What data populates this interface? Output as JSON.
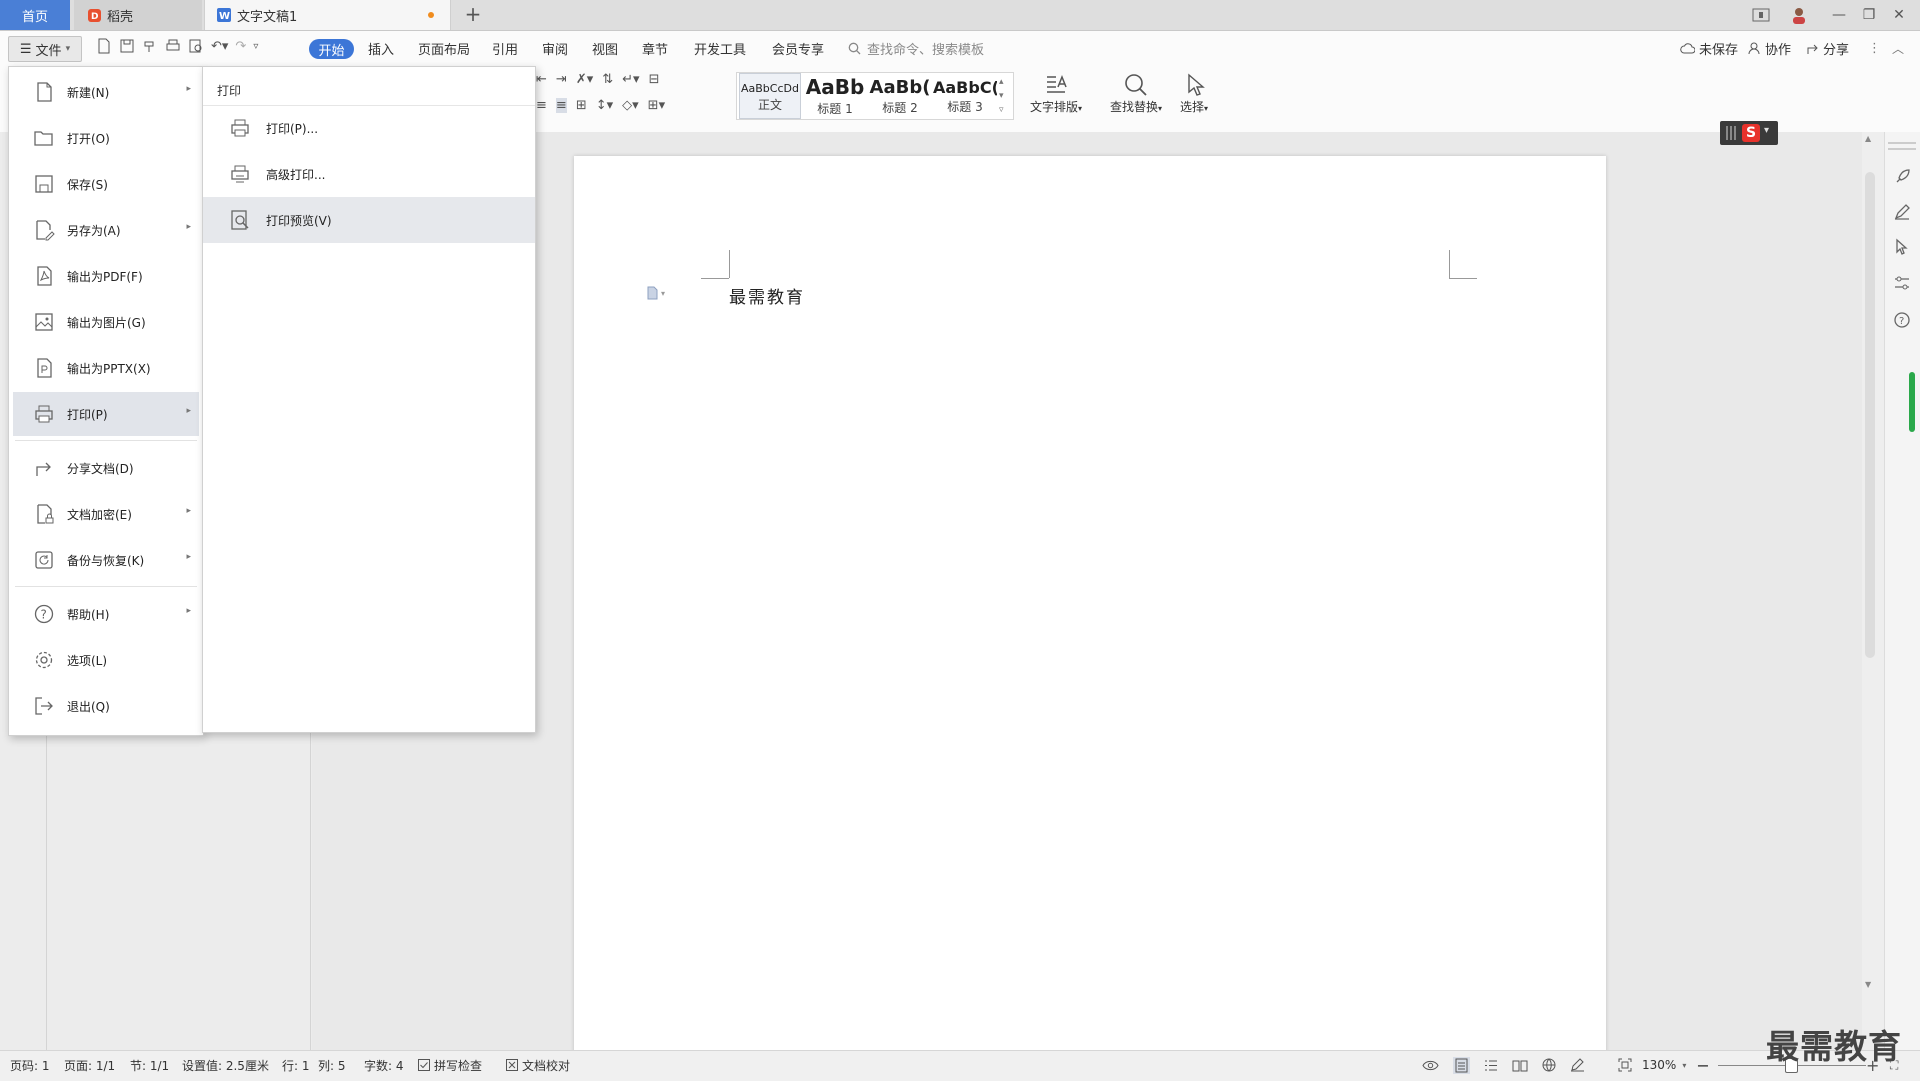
{
  "tabs": {
    "home": "首页",
    "docer": "稻壳",
    "document": "文字文稿1",
    "new_tab": "+"
  },
  "menubar": {
    "file": "文件",
    "items": [
      "开始",
      "插入",
      "页面布局",
      "引用",
      "审阅",
      "视图",
      "章节",
      "开发工具",
      "会员专享"
    ],
    "search_placeholder": "查找命令、搜索模板",
    "right": {
      "unsaved": "未保存",
      "collab": "协作",
      "share": "分享"
    }
  },
  "ribbon": {
    "styles": [
      {
        "sample": "AaBbCcDd",
        "label": "正文"
      },
      {
        "sample": "AaBb",
        "label": "标题 1"
      },
      {
        "sample": "AaBb(",
        "label": "标题 2"
      },
      {
        "sample": "AaBbC(",
        "label": "标题 3"
      }
    ],
    "text_layout": "文字排版",
    "find_replace": "查找替换",
    "select": "选择"
  },
  "file_menu": {
    "items": [
      {
        "label": "新建(N)",
        "icon": "new-doc-icon",
        "has_arrow": true
      },
      {
        "label": "打开(O)",
        "icon": "folder-open-icon",
        "has_arrow": false
      },
      {
        "label": "保存(S)",
        "icon": "save-icon",
        "has_arrow": false
      },
      {
        "label": "另存为(A)",
        "icon": "save-as-icon",
        "has_arrow": true
      },
      {
        "label": "输出为PDF(F)",
        "icon": "pdf-export-icon",
        "has_arrow": false
      },
      {
        "label": "输出为图片(G)",
        "icon": "image-export-icon",
        "has_arrow": false
      },
      {
        "label": "输出为PPTX(X)",
        "icon": "pptx-export-icon",
        "has_arrow": false
      },
      {
        "label": "打印(P)",
        "icon": "printer-icon",
        "has_arrow": true,
        "active": true
      },
      {
        "label": "分享文档(D)",
        "icon": "share-icon",
        "has_arrow": false
      },
      {
        "label": "文档加密(E)",
        "icon": "lock-doc-icon",
        "has_arrow": true
      },
      {
        "label": "备份与恢复(K)",
        "icon": "backup-icon",
        "has_arrow": true
      },
      {
        "label": "帮助(H)",
        "icon": "help-icon",
        "has_arrow": true
      },
      {
        "label": "选项(L)",
        "icon": "gear-icon",
        "has_arrow": false
      },
      {
        "label": "退出(Q)",
        "icon": "exit-icon",
        "has_arrow": false
      }
    ]
  },
  "print_submenu": {
    "title": "打印",
    "items": [
      {
        "label": "打印(P)...",
        "icon": "printer-icon"
      },
      {
        "label": "高级打印...",
        "icon": "advanced-print-icon"
      },
      {
        "label": "打印预览(V)",
        "icon": "print-preview-icon",
        "hover": true
      }
    ]
  },
  "document": {
    "text": "最需教育"
  },
  "statusbar": {
    "page_no": "页码: 1",
    "pages": "页面: 1/1",
    "section": "节: 1/1",
    "setting": "设置值: 2.5厘米",
    "row": "行: 1",
    "col": "列: 5",
    "words": "字数: 4",
    "spell_check": "拼写检查",
    "doc_check": "文档校对",
    "zoom": "130%"
  },
  "watermark": "最需教育",
  "colors": {
    "accent": "#3c76d7",
    "home_tab": "#4a7fd6",
    "unsaved_dot": "#f08c1e"
  }
}
